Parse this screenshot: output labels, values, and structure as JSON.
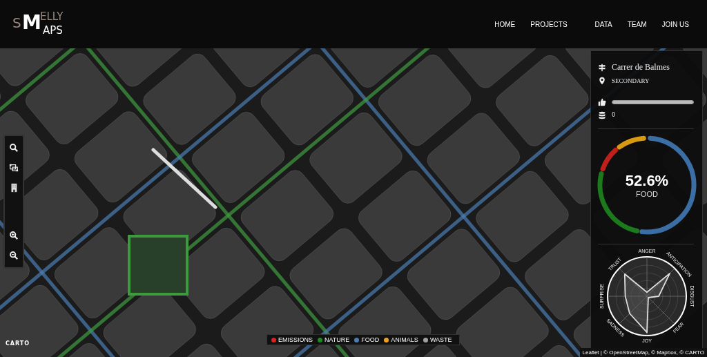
{
  "header": {
    "logo": {
      "small_1": "S",
      "big_1": "M",
      "small_2": "ELLY",
      "small_3": "APS"
    },
    "nav": [
      {
        "label": "HOME"
      },
      {
        "label": "PROJECTS"
      },
      {
        "label": "DATA"
      },
      {
        "label": "TEAM"
      },
      {
        "label": "JOIN US"
      }
    ]
  },
  "panel": {
    "street": "Carrer de Balmes",
    "road_type": "SECONDARY",
    "likes": {
      "level": 1
    },
    "count": "0",
    "donut": {
      "value": "52.6%",
      "label": "FOOD"
    },
    "emotions": [
      "ANGER",
      "ANTICIPATION",
      "DISGUST",
      "FEAR",
      "JOY",
      "SADNESS",
      "SURPRISE",
      "TRUST"
    ]
  },
  "legend": [
    {
      "label": "EMISSIONS",
      "color": "#e02020"
    },
    {
      "label": "NATURE",
      "color": "#1f8a1f"
    },
    {
      "label": "FOOD",
      "color": "#4a7db5"
    },
    {
      "label": "ANIMALS",
      "color": "#f0a020"
    },
    {
      "label": "WASTE",
      "color": "#a0a0a0"
    }
  ],
  "attribution": {
    "link": "Leaflet",
    "text": "| © OpenStreetMap, © Mapbox, © CARTO"
  },
  "carto_logo": "CARTO"
}
